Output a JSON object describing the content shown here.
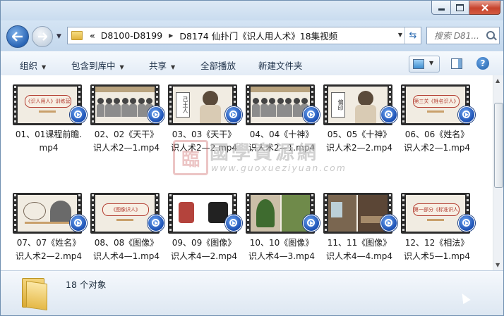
{
  "address": {
    "crumbs": [
      "D8100-D8199",
      "D8174 仙扑门《识人用人术》18集视频"
    ],
    "overflow_symbol": "«",
    "search_placeholder": "搜索 D81..."
  },
  "toolbar": {
    "organize": "组织",
    "include_in_library": "包含到库中",
    "share": "共享",
    "play_all": "全部播放",
    "new_folder": "新建文件夹"
  },
  "files": [
    {
      "line1": "01、01课程前瞻.",
      "line2": "mp4",
      "thumb_text": "《识人用人》训练营",
      "style": "title-banner"
    },
    {
      "line1": "02、02《天干》",
      "line2": "识人术2—1.mp4",
      "thumb_text": "",
      "style": "crowd"
    },
    {
      "line1": "03、03《天干》",
      "line2": "识人术2—2.mp4",
      "thumb_text": "己土人",
      "style": "portrait"
    },
    {
      "line1": "04、04《十神》",
      "line2": "识人术2—1.mp4",
      "thumb_text": "",
      "style": "crowd"
    },
    {
      "line1": "05、05《十神》",
      "line2": "识人术2—2.mp4",
      "thumb_text": "偏印",
      "style": "portrait"
    },
    {
      "line1": "06、06《姓名》",
      "line2": "识人术2—1.mp4",
      "thumb_text": "第三关《姓名识人》",
      "style": "title-banner"
    },
    {
      "line1": "07、07《姓名》",
      "line2": "识人术2—2.mp4",
      "thumb_text": "",
      "style": "diagram"
    },
    {
      "line1": "08、08《图像》",
      "line2": "识人术4—1.mp4",
      "thumb_text": "《图像识人》",
      "style": "title-banner"
    },
    {
      "line1": "09、09《图像》",
      "line2": "识人术4—2.mp4",
      "thumb_text": "",
      "style": "shirts"
    },
    {
      "line1": "10、10《图像》",
      "line2": "识人术4—3.mp4",
      "thumb_text": "",
      "style": "trees"
    },
    {
      "line1": "11、11《图像》",
      "line2": "识人术4—4.mp4",
      "thumb_text": "",
      "style": "rooms"
    },
    {
      "line1": "12、12《相法》",
      "line2": "识人术5—1.mp4",
      "thumb_text": "第一部分《标准识人》",
      "style": "title-banner"
    }
  ],
  "status": {
    "count_text": "18 个对象"
  },
  "watermark": {
    "seal": "臨",
    "name": "國學資源網",
    "url": "www.guoxueziyuan.com"
  },
  "colors": {
    "accent": "#2a65b5",
    "close": "#c7432d",
    "thumb_bg": "#f1ece2",
    "banner_red": "#b23a2e"
  }
}
